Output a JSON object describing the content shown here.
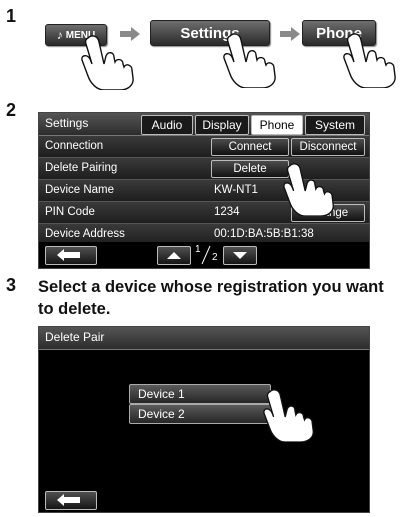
{
  "steps": {
    "one": "1",
    "two": "2",
    "three": "3",
    "three_text": "Select a device whose registration you want to delete."
  },
  "step1": {
    "menu_label": "MENU",
    "settings_label": "Settings",
    "phone_label": "Phone"
  },
  "settings_screen": {
    "title": "Settings",
    "tabs": [
      "Audio",
      "Display",
      "Phone",
      "System"
    ],
    "active_tab": "Phone",
    "rows": [
      {
        "label": "Connection",
        "connect": "Connect",
        "disconnect": "Disconnect"
      },
      {
        "label": "Delete Pairing",
        "button": "Delete"
      },
      {
        "label": "Device Name",
        "value": "KW-NT1"
      },
      {
        "label": "PIN Code",
        "value": "1234",
        "button": "Change"
      },
      {
        "label": "Device Address",
        "value": "00:1D:BA:5B:B1:38"
      }
    ],
    "page_current": "1",
    "page_total": "2"
  },
  "delete_screen": {
    "title": "Delete Pair",
    "devices": [
      "Device 1",
      "Device 2"
    ]
  },
  "colors": {
    "screen_bg": "#000000",
    "button_face": "#2a2a2a"
  },
  "icons": [
    "music-note-icon",
    "arrow-right-icon",
    "pointing-hand-icon",
    "back-arrow-icon",
    "page-up-icon",
    "page-down-icon"
  ]
}
